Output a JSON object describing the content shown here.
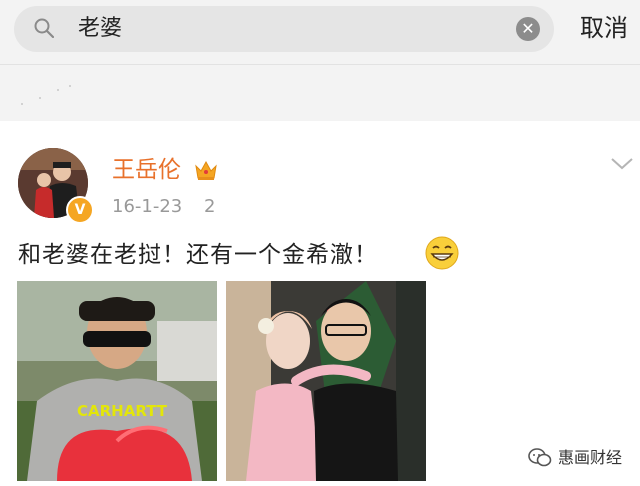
{
  "search": {
    "query": "老婆",
    "cancel_label": "取消"
  },
  "post": {
    "username": "王岳伦",
    "date": "16-1-23",
    "date_extra": "2",
    "text": "和老婆在老挝！还有一个金希澈！",
    "photo1_shirt_text": "CARHARTT"
  },
  "watermark": {
    "text": "惠画财经"
  },
  "colors": {
    "username": "#e8712b",
    "verified_badge": "#f5a623",
    "search_bg": "#e5e5e5",
    "topbar_bg": "#f3f3f3"
  },
  "icons": {
    "search": "search-icon",
    "clear": "clear-icon",
    "verified": "verified-badge-icon",
    "crown": "crown-icon",
    "menu": "chevron-down-icon",
    "emoji": "grin-emoji-icon",
    "watermark": "wechat-icon"
  }
}
